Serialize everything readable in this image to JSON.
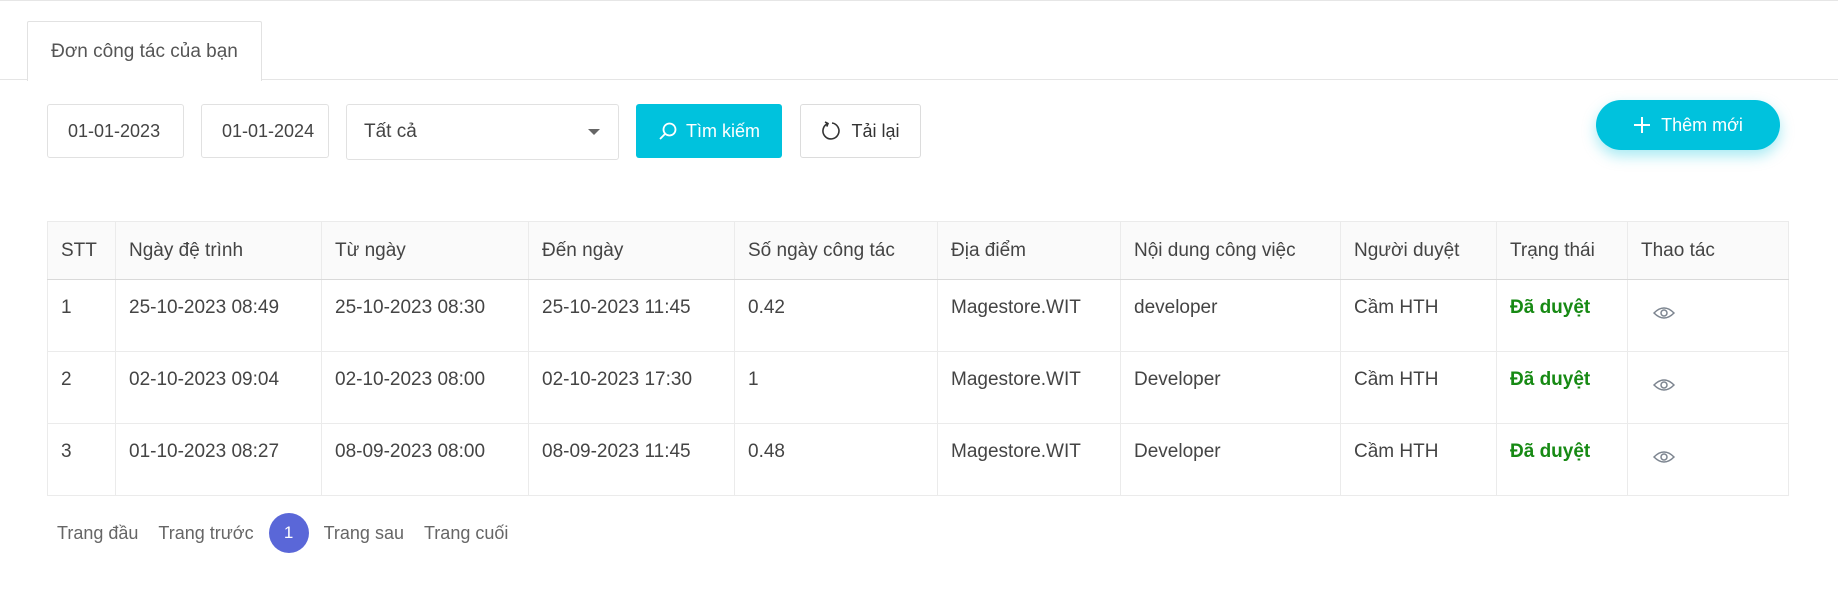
{
  "tabs": [
    {
      "label": "Đơn công tác của bạn"
    }
  ],
  "filters": {
    "from_date": "01-01-2023",
    "to_date": "01-01-2024",
    "status_select": "Tất cả"
  },
  "buttons": {
    "search": "Tìm kiếm",
    "reload": "Tải lại",
    "add_new": "Thêm mới"
  },
  "colors": {
    "accent": "#00c2dd",
    "approved": "#178a14",
    "page_active": "#5a67d8"
  },
  "table": {
    "headers": [
      "STT",
      "Ngày đệ trình",
      "Từ ngày",
      "Đến ngày",
      "Số ngày công tác",
      "Địa điểm",
      "Nội dung công việc",
      "Người duyệt",
      "Trạng thái",
      "Thao tác"
    ],
    "rows": [
      [
        "1",
        "25-10-2023 08:49",
        "25-10-2023 08:30",
        "25-10-2023 11:45",
        "0.42",
        "Magestore.WIT",
        "developer",
        "Cầm HTH",
        "Đã duyệt"
      ],
      [
        "2",
        "02-10-2023 09:04",
        "02-10-2023 08:00",
        "02-10-2023 17:30",
        "1",
        "Magestore.WIT",
        "Developer",
        "Cầm HTH",
        "Đã duyệt"
      ],
      [
        "3",
        "01-10-2023 08:27",
        "08-09-2023 08:00",
        "08-09-2023 11:45",
        "0.48",
        "Magestore.WIT",
        "Developer",
        "Cầm HTH",
        "Đã duyệt"
      ]
    ],
    "action_icon": "eye-icon"
  },
  "pagination": {
    "first": "Trang đầu",
    "prev": "Trang trước",
    "current": "1",
    "next": "Trang sau",
    "last": "Trang cuối"
  }
}
